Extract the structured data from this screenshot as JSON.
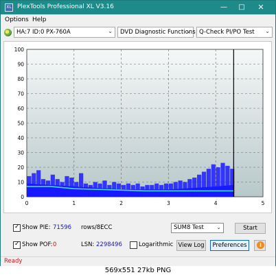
{
  "window": {
    "title": "PlexTools Professional XL V3.16",
    "app_icon": "XL",
    "controls": {
      "minimize": "—",
      "maximize": "□",
      "close": "✕"
    }
  },
  "menu": {
    "options": "Options",
    "help": "Help"
  },
  "toolbar": {
    "drive_icon": "disc-icon",
    "drive": "HA:7 ID:0  PX-760A",
    "function": "DVD Diagnostic Functions",
    "test": "Q-Check  PI/PO Test",
    "chevron": "⌄"
  },
  "chart_data": {
    "type": "area",
    "x_range": [
      0,
      5
    ],
    "y_range": [
      0,
      100
    ],
    "x_ticks": [
      "0",
      "1",
      "2",
      "3",
      "4",
      "5"
    ],
    "y_ticks": [
      "100",
      "90",
      "80",
      "70",
      "60",
      "50",
      "40",
      "30",
      "20",
      "10",
      "0"
    ],
    "grid": true,
    "data_end_x": 4.38,
    "pie_spikes": [
      [
        0.05,
        14
      ],
      [
        0.15,
        16
      ],
      [
        0.25,
        18
      ],
      [
        0.35,
        12
      ],
      [
        0.45,
        11
      ],
      [
        0.55,
        15
      ],
      [
        0.65,
        12
      ],
      [
        0.75,
        10
      ],
      [
        0.85,
        14
      ],
      [
        0.95,
        13
      ],
      [
        1.05,
        10
      ],
      [
        1.15,
        16
      ],
      [
        1.25,
        9
      ],
      [
        1.35,
        8
      ],
      [
        1.45,
        10
      ],
      [
        1.55,
        9
      ],
      [
        1.65,
        11
      ],
      [
        1.75,
        8
      ],
      [
        1.85,
        10
      ],
      [
        1.95,
        9
      ],
      [
        2.05,
        8
      ],
      [
        2.15,
        9
      ],
      [
        2.25,
        8
      ],
      [
        2.35,
        9
      ],
      [
        2.45,
        7
      ],
      [
        2.55,
        8
      ],
      [
        2.65,
        8
      ],
      [
        2.75,
        9
      ],
      [
        2.85,
        8
      ],
      [
        2.95,
        9
      ],
      [
        3.05,
        9
      ],
      [
        3.15,
        10
      ],
      [
        3.25,
        11
      ],
      [
        3.35,
        10
      ],
      [
        3.45,
        12
      ],
      [
        3.55,
        13
      ],
      [
        3.65,
        15
      ],
      [
        3.75,
        17
      ],
      [
        3.85,
        19
      ],
      [
        3.95,
        22
      ],
      [
        4.05,
        20
      ],
      [
        4.15,
        23
      ],
      [
        4.25,
        21
      ],
      [
        4.35,
        19
      ]
    ],
    "pie_base": [
      [
        0,
        9
      ],
      [
        0.5,
        8
      ],
      [
        1.0,
        7
      ],
      [
        1.5,
        6
      ],
      [
        2.0,
        5
      ],
      [
        2.5,
        5
      ],
      [
        3.0,
        5
      ],
      [
        3.5,
        6
      ],
      [
        4.0,
        7
      ],
      [
        4.38,
        8
      ]
    ],
    "avg_line": [
      [
        0,
        7
      ],
      [
        0.5,
        7
      ],
      [
        1.0,
        5.5
      ],
      [
        1.5,
        5
      ],
      [
        2.0,
        4.5
      ],
      [
        2.5,
        4
      ],
      [
        3.0,
        4
      ],
      [
        3.5,
        4
      ],
      [
        4.0,
        4
      ],
      [
        4.38,
        4
      ]
    ],
    "colors": {
      "plot_bg_top": "#f5f8f8",
      "plot_bg_bottom": "#b8c8c9",
      "bars": "#1a1aff",
      "avg": "#40e0d0",
      "end_line": "#000000"
    }
  },
  "controls": {
    "show_pie_label": "Show PIE:",
    "pie_value": "71596",
    "pie_unit": "rows/8ECC",
    "show_pof_label": "Show POF:",
    "pof_value": "0",
    "lsn_label": "LSN:",
    "lsn_value": "2298496",
    "logarithmic_label": "Logarithmic",
    "sum_select": "SUM8 Test",
    "start_button": "Start",
    "viewlog_button": "View Log",
    "preferences_button": "Preferences",
    "info_button": "i",
    "tick": "✓"
  },
  "status": {
    "text": "Ready"
  },
  "caption": {
    "text": "569x551  27kb  PNG"
  }
}
